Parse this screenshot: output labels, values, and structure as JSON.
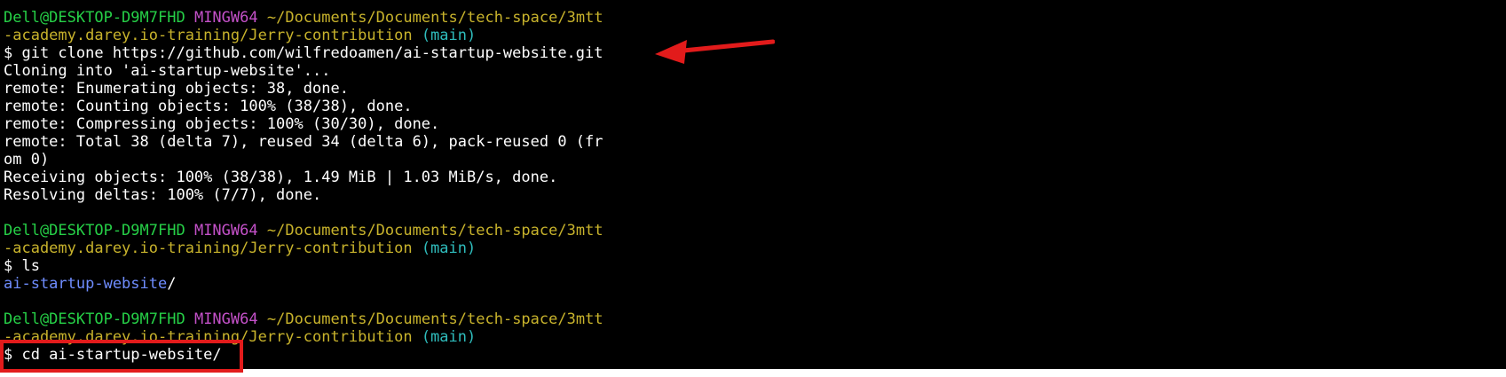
{
  "terminal": {
    "blocks": [
      {
        "prompt": {
          "user_host": "Dell@DESKTOP-D9M7FHD",
          "env": "MINGW64",
          "path_line1": "~/Documents/Documents/tech-space/3mtt",
          "path_line2": "-academy.darey.io-training/Jerry-contribution",
          "branch": "(main)"
        },
        "command": "$ git clone https://github.com/wilfredoamen/ai-startup-website.git",
        "output": [
          "Cloning into 'ai-startup-website'...",
          "remote: Enumerating objects: 38, done.",
          "remote: Counting objects: 100% (38/38), done.",
          "remote: Compressing objects: 100% (30/30), done.",
          "remote: Total 38 (delta 7), reused 34 (delta 6), pack-reused 0 (fr",
          "om 0)",
          "Receiving objects: 100% (38/38), 1.49 MiB | 1.03 MiB/s, done.",
          "Resolving deltas: 100% (7/7), done."
        ]
      },
      {
        "prompt": {
          "user_host": "Dell@DESKTOP-D9M7FHD",
          "env": "MINGW64",
          "path_line1": "~/Documents/Documents/tech-space/3mtt",
          "path_line2": "-academy.darey.io-training/Jerry-contribution",
          "branch": "(main)"
        },
        "command": "$ ls",
        "dir_listing": "ai-startup-website",
        "dir_suffix": "/"
      },
      {
        "prompt": {
          "user_host": "Dell@DESKTOP-D9M7FHD",
          "env": "MINGW64",
          "path_line1": "~/Documents/Documents/tech-space/3mtt",
          "path_line2": "-academy.darey.io-training/Jerry-contribution",
          "branch": "(main)"
        },
        "command": "$ cd ai-startup-website/"
      }
    ]
  },
  "annotations": {
    "arrow_color": "#e21b1b",
    "box_color": "#e21b1b"
  }
}
